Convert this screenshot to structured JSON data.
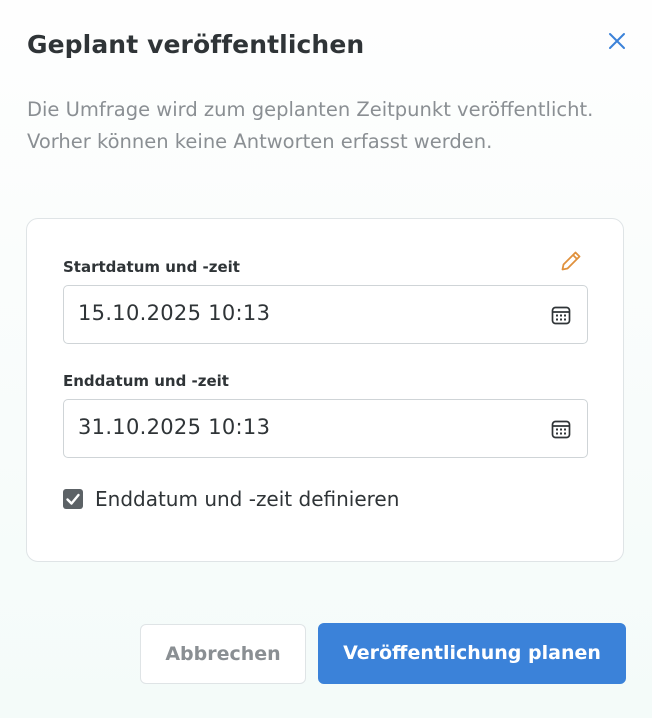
{
  "dialog": {
    "title": "Geplant veröffentlichen",
    "description": "Die Umfrage wird zum geplanten Zeitpunkt veröffentlicht. Vorher können keine Antworten erfasst werden."
  },
  "start": {
    "label": "Startdatum und -zeit",
    "value": "15.10.2025 10:13"
  },
  "end": {
    "label": "Enddatum und -zeit",
    "value": "31.10.2025 10:13"
  },
  "define_end": {
    "label": "Enddatum und -zeit definieren",
    "checked": true
  },
  "buttons": {
    "cancel": "Abbrechen",
    "submit": "Veröffentlichung planen"
  },
  "colors": {
    "primary": "#3b82d9",
    "edit_icon": "#e0913d",
    "close_icon": "#3b82d9"
  },
  "icons": {
    "close": "close-icon",
    "edit": "pencil-icon",
    "calendar": "calendar-icon",
    "check": "checkmark-icon"
  }
}
